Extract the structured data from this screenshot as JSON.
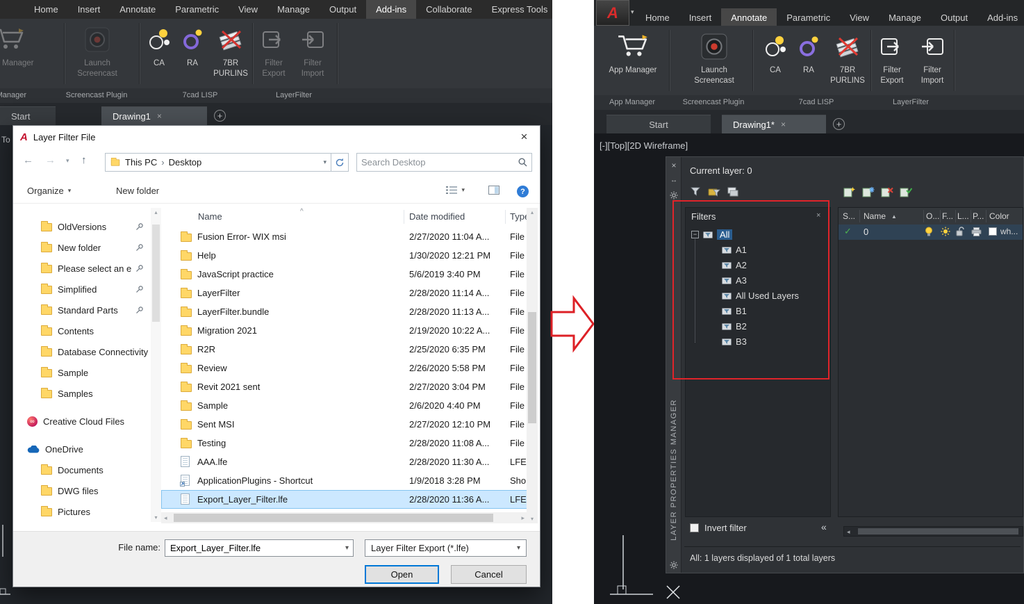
{
  "glyphs": {
    "a_logo": "A",
    "close": "×",
    "back": "←",
    "forward": "→",
    "up_arrow": "↑",
    "chevron_down": "▾",
    "chevron_up": "▴",
    "chevron_left": "◂",
    "chevron_right": "▸",
    "crumb": "›",
    "sort_caret": "^",
    "sort_triangle": "▲",
    "collapse": "«",
    "plus": "+",
    "minus": "−",
    "check": "✓",
    "question": "?",
    "autohide": "↔",
    "infinity": "∞"
  },
  "left_window": {
    "ribbon_tabs": [
      "Home",
      "Insert",
      "Annotate",
      "Parametric",
      "View",
      "Manage",
      "Output",
      "Add-ins",
      "Collaborate",
      "Express Tools"
    ],
    "panel_labels": [
      "App Manager",
      "Screencast Plugin",
      "7cad LISP",
      "LayerFilter"
    ],
    "buttons": {
      "app_manager": "App Manager",
      "launch_line1": "Launch",
      "launch_line2": "Screencast",
      "ca": "CA",
      "ra": "RA",
      "purlins_line1": "7BR",
      "purlins_line2": "PURLINS",
      "filter_export_line1": "Filter",
      "filter_export_line2": "Export",
      "filter_import_line1": "Filter",
      "filter_import_line2": "Import"
    },
    "doc_tabs": {
      "start": "Start",
      "drawing": "Drawing1"
    },
    "canvas_text": "To"
  },
  "dialog": {
    "title": "Layer Filter File",
    "breadcrumb": {
      "root": "This PC",
      "leaf": "Desktop"
    },
    "search_placeholder": "Search Desktop",
    "toolbar": {
      "organize": "Organize",
      "new_folder": "New folder"
    },
    "columns": {
      "name": "Name",
      "date": "Date modified",
      "type": "Type"
    },
    "sidebar": [
      "OldVersions",
      "New folder",
      "Please select an e",
      "Simplified",
      "Standard Parts",
      "Contents",
      "Database Connectivity",
      "Sample",
      "Samples",
      "Creative Cloud Files",
      "OneDrive",
      "Documents",
      "DWG files",
      "Pictures"
    ],
    "files": [
      {
        "name": "Fusion Error- WIX msi",
        "date": "2/27/2020 11:04 A...",
        "type": "File folder"
      },
      {
        "name": "Help",
        "date": "1/30/2020 12:21 PM",
        "type": "File folder"
      },
      {
        "name": "JavaScript practice",
        "date": "5/6/2019 3:40 PM",
        "type": "File folder"
      },
      {
        "name": "LayerFilter",
        "date": "2/28/2020 11:14 A...",
        "type": "File folder"
      },
      {
        "name": "LayerFilter.bundle",
        "date": "2/28/2020 11:13 A...",
        "type": "File folder"
      },
      {
        "name": "Migration 2021",
        "date": "2/19/2020 10:22 A...",
        "type": "File folder"
      },
      {
        "name": "R2R",
        "date": "2/25/2020 6:35 PM",
        "type": "File folder"
      },
      {
        "name": "Review",
        "date": "2/26/2020 5:58 PM",
        "type": "File folder"
      },
      {
        "name": "Revit 2021 sent",
        "date": "2/27/2020 3:04 PM",
        "type": "File folder"
      },
      {
        "name": "Sample",
        "date": "2/6/2020 4:40 PM",
        "type": "File folder"
      },
      {
        "name": "Sent MSI",
        "date": "2/27/2020 12:10 PM",
        "type": "File folder"
      },
      {
        "name": "Testing",
        "date": "2/28/2020 11:08 A...",
        "type": "File folder"
      },
      {
        "name": "AAA.lfe",
        "date": "2/28/2020 11:30 A...",
        "type": "LFE File"
      },
      {
        "name": "ApplicationPlugins - Shortcut",
        "date": "1/9/2018 3:28 PM",
        "type": "Shortcut"
      },
      {
        "name": "Export_Layer_Filter.lfe",
        "date": "2/28/2020 11:36 A...",
        "type": "LFE File"
      }
    ],
    "footer": {
      "file_name_label": "File name:",
      "file_name_value": "Export_Layer_Filter.lfe",
      "file_type_value": "Layer Filter Export (*.lfe)",
      "open_label": "Open",
      "cancel_label": "Cancel"
    }
  },
  "right_window": {
    "ribbon_tabs": [
      "Home",
      "Insert",
      "Annotate",
      "Parametric",
      "View",
      "Manage",
      "Output",
      "Add-ins"
    ],
    "panel_labels": [
      "App Manager",
      "Screencast Plugin",
      "7cad LISP",
      "LayerFilter"
    ],
    "buttons": {
      "app_manager": "App Manager",
      "launch_line1": "Launch",
      "launch_line2": "Screencast",
      "ca": "CA",
      "ra": "RA",
      "purlins_line1": "7BR",
      "purlins_line2": "PURLINS",
      "filter_export_line1": "Filter",
      "filter_export_line2": "Export",
      "filter_import_line1": "Filter",
      "filter_import_line2": "Import"
    },
    "doc_tabs": {
      "start": "Start",
      "drawing": "Drawing1*"
    },
    "viewport_label": "[-][Top][2D Wireframe]",
    "palette": {
      "vertical_title": "LAYER PROPERTIES MANAGER",
      "current_layer": "Current layer: 0",
      "filters_header": "Filters",
      "tree": [
        "All",
        "A1",
        "A2",
        "A3",
        "All Used Layers",
        "B1",
        "B2",
        "B3"
      ],
      "columns": [
        "S...",
        "Name",
        "O...",
        "F...",
        "L...",
        "P...",
        "Color"
      ],
      "layer_row": {
        "name": "0",
        "color": "wh..."
      },
      "invert_filter_label": "Invert filter",
      "status": "All: 1 layers displayed of 1 total layers"
    }
  },
  "colors": {
    "selection_blue": "#cce8ff",
    "arrow_red": "#dd2026",
    "highlight_red": "#e0242a",
    "tree_select_blue": "#2a5d8f"
  }
}
